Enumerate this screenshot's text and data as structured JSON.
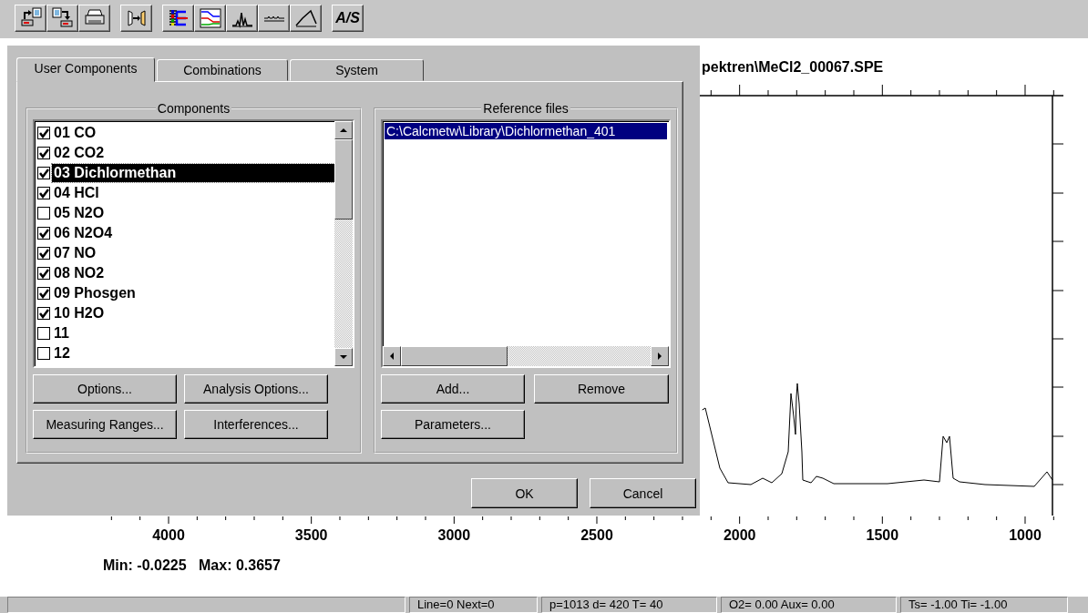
{
  "toolbar": {
    "text_button": "A/S"
  },
  "spectrum": {
    "title": "pektren\\MeCl2_00067.SPE",
    "x_axis_labels": [
      "4000",
      "3500",
      "3000",
      "2500",
      "2000",
      "1500",
      "1000"
    ],
    "min_text": "Min: -0.0225",
    "max_text": "Max: 0.3657"
  },
  "dialog": {
    "tabs": [
      {
        "label": "User Components",
        "selected": true
      },
      {
        "label": "Combinations",
        "selected": false
      },
      {
        "label": "System",
        "selected": false
      }
    ],
    "components": {
      "title": "Components",
      "items": [
        {
          "label": "01 CO",
          "checked": true,
          "selected": false
        },
        {
          "label": "02 CO2",
          "checked": true,
          "selected": false
        },
        {
          "label": "03 Dichlormethan",
          "checked": true,
          "selected": true
        },
        {
          "label": "04 HCl",
          "checked": true,
          "selected": false
        },
        {
          "label": "05 N2O",
          "checked": false,
          "selected": false
        },
        {
          "label": "06 N2O4",
          "checked": true,
          "selected": false
        },
        {
          "label": "07 NO",
          "checked": true,
          "selected": false
        },
        {
          "label": "08 NO2",
          "checked": true,
          "selected": false
        },
        {
          "label": "09 Phosgen",
          "checked": true,
          "selected": false
        },
        {
          "label": "10 H2O",
          "checked": true,
          "selected": false
        },
        {
          "label": "11",
          "checked": false,
          "selected": false
        },
        {
          "label": "12",
          "checked": false,
          "selected": false
        }
      ],
      "buttons": [
        "Options...",
        "Analysis Options...",
        "Measuring Ranges...",
        "Interferences..."
      ]
    },
    "reference_files": {
      "title": "Reference files",
      "items": [
        {
          "label": "C:\\Calcmetw\\Library\\Dichlormethan_401",
          "selected": true
        }
      ],
      "buttons": [
        "Add...",
        "Remove",
        "Parameters..."
      ]
    },
    "footer_buttons": [
      "OK",
      "Cancel"
    ]
  },
  "status_bar": {
    "panels": [
      "Line=0 Next=0",
      "p=1013 d= 420 T= 40",
      "O2= 0.00 Aux= 0.00",
      "Ts= -1.00 Ti= -1.00"
    ]
  }
}
